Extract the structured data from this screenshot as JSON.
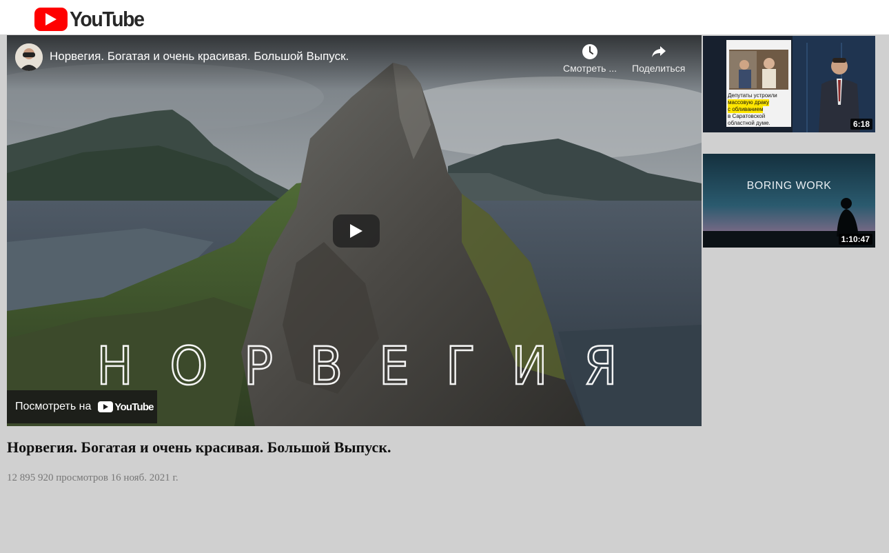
{
  "header": {
    "logo_text": "YouTube"
  },
  "player": {
    "title": "Норвегия. Богатая и очень красивая. Большой Выпуск.",
    "watch_later_label": "Смотреть ...",
    "share_label": "Поделиться",
    "overlay_letters": [
      "Н",
      "О",
      "Р",
      "В",
      "Е",
      "Г",
      "И",
      "Я"
    ],
    "watch_on_label": "Посмотреть на",
    "watch_on_logo_text": "YouTube"
  },
  "video": {
    "title": "Норвегия. Богатая и очень красивая. Большой Выпуск.",
    "meta": "12 895 920 просмотров 16 нояб. 2021 г."
  },
  "related": [
    {
      "duration": "6:18",
      "caption_lines": [
        "Депутаты устроили",
        "массовую драку",
        "с обливанием",
        "в Саратовской",
        "областной думе."
      ]
    },
    {
      "duration": "1:10:47",
      "overlay_text": "BORING WORK"
    }
  ],
  "colors": {
    "brand_red": "#ff0000",
    "page_background": "#d0d0d0"
  }
}
